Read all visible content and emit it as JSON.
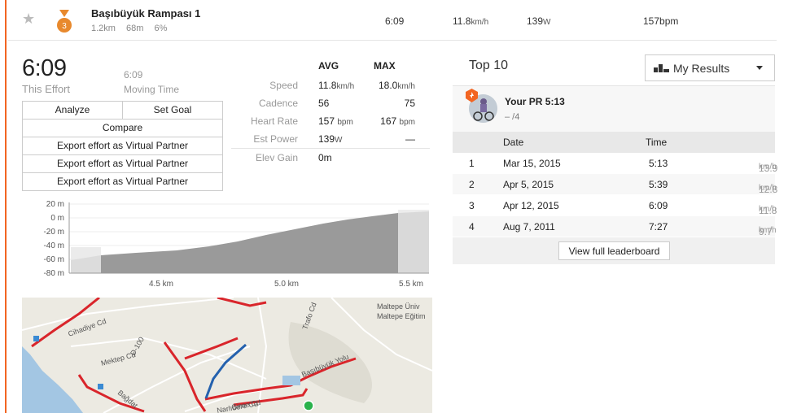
{
  "segment": {
    "name": "Başıbüyük Rampası 1",
    "distance": "1.2km",
    "elevation": "68m",
    "grade": "6%",
    "rank_badge": "3",
    "time": "6:09",
    "speed_value": "11.8",
    "speed_unit": "km/h",
    "power_value": "139",
    "power_unit": "W",
    "heart_rate": "157bpm",
    "medal_color": "#e8892d"
  },
  "effort": {
    "time": "6:09",
    "time_label": "This Effort",
    "moving_time": "6:09",
    "moving_label": "Moving Time"
  },
  "buttons": {
    "analyze": "Analyze",
    "set_goal": "Set Goal",
    "compare": "Compare",
    "export_1": "Export effort as Virtual Partner",
    "export_2": "Export effort as Virtual Partner",
    "export_3": "Export effort as Virtual Partner"
  },
  "stats": {
    "avg_header": "AVG",
    "max_header": "MAX",
    "rows": [
      {
        "label": "Speed",
        "avg": "11.8",
        "avg_unit": "km/h",
        "max": "18.0",
        "max_unit": "km/h"
      },
      {
        "label": "Cadence",
        "avg": "56",
        "avg_unit": "",
        "max": "75",
        "max_unit": ""
      },
      {
        "label": "Heart Rate",
        "avg": "157",
        "avg_unit": "bpm",
        "max": "167",
        "max_unit": "bpm"
      },
      {
        "label": "Est Power",
        "avg": "139",
        "avg_unit": "W",
        "max": "—",
        "max_unit": ""
      },
      {
        "label": "Elev Gain",
        "avg": "0m",
        "avg_unit": "",
        "max": "",
        "max_unit": ""
      }
    ]
  },
  "elevation_chart": {
    "y_ticks": [
      "20 m",
      "0 m",
      "-20 m",
      "-40 m",
      "-60 m",
      "-80 m"
    ],
    "x_ticks": [
      "4.5 km",
      "5.0 km",
      "5.5 km"
    ]
  },
  "map": {
    "labels": [
      "Cihadiye Cd",
      "Mektep Cd",
      "D-100",
      "Trafo Cd",
      "Maltepe Üniv",
      "Maltepe Eğitim",
      "Başıbüyük Yolu",
      "Girne Cd",
      "Narlıdere Cd",
      "Bağdat"
    ]
  },
  "leaderboard": {
    "title": "Top 10",
    "filter": "My Results",
    "pr_label": "Your PR 5:13",
    "pr_rank": "– /4",
    "col_date": "Date",
    "col_time": "Time",
    "rows": [
      {
        "rank": "1",
        "date": "Mar 15, 2015",
        "time": "5:13",
        "speed": "13.9",
        "unit": "km/h"
      },
      {
        "rank": "2",
        "date": "Apr 5, 2015",
        "time": "5:39",
        "speed": "12.8",
        "unit": "km/h"
      },
      {
        "rank": "3",
        "date": "Apr 12, 2015",
        "time": "6:09",
        "speed": "11.8",
        "unit": "km/h"
      },
      {
        "rank": "4",
        "date": "Aug 7, 2011",
        "time": "7:27",
        "speed": "9.7",
        "unit": "km/h"
      }
    ],
    "full_button": "View full leaderboard"
  }
}
